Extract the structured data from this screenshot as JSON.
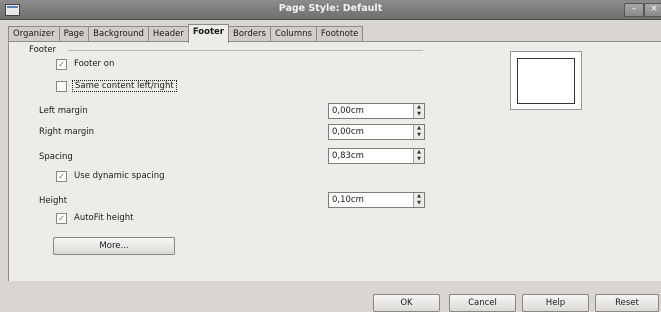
{
  "window": {
    "title": "Page Style: Default"
  },
  "tabs": [
    {
      "label": "Organizer"
    },
    {
      "label": "Page"
    },
    {
      "label": "Background"
    },
    {
      "label": "Header"
    },
    {
      "label": "Footer"
    },
    {
      "label": "Borders"
    },
    {
      "label": "Columns"
    },
    {
      "label": "Footnote"
    }
  ],
  "footer": {
    "section_label": "Footer",
    "footer_on": {
      "label": "Footer on",
      "checked": true
    },
    "same_content": {
      "label": "Same content left/right",
      "checked": false
    },
    "left_margin": {
      "label": "Left margin",
      "value": "0,00cm"
    },
    "right_margin": {
      "label": "Right margin",
      "value": "0,00cm"
    },
    "spacing": {
      "label": "Spacing",
      "value": "0,83cm"
    },
    "dynamic_spacing": {
      "label": "Use dynamic spacing",
      "checked": true
    },
    "height": {
      "label": "Height",
      "value": "0,10cm"
    },
    "autofit": {
      "label": "AutoFit height",
      "checked": true
    },
    "more_label": "More..."
  },
  "buttons": {
    "ok": "OK",
    "cancel": "Cancel",
    "help": "Help",
    "reset": "Reset"
  }
}
